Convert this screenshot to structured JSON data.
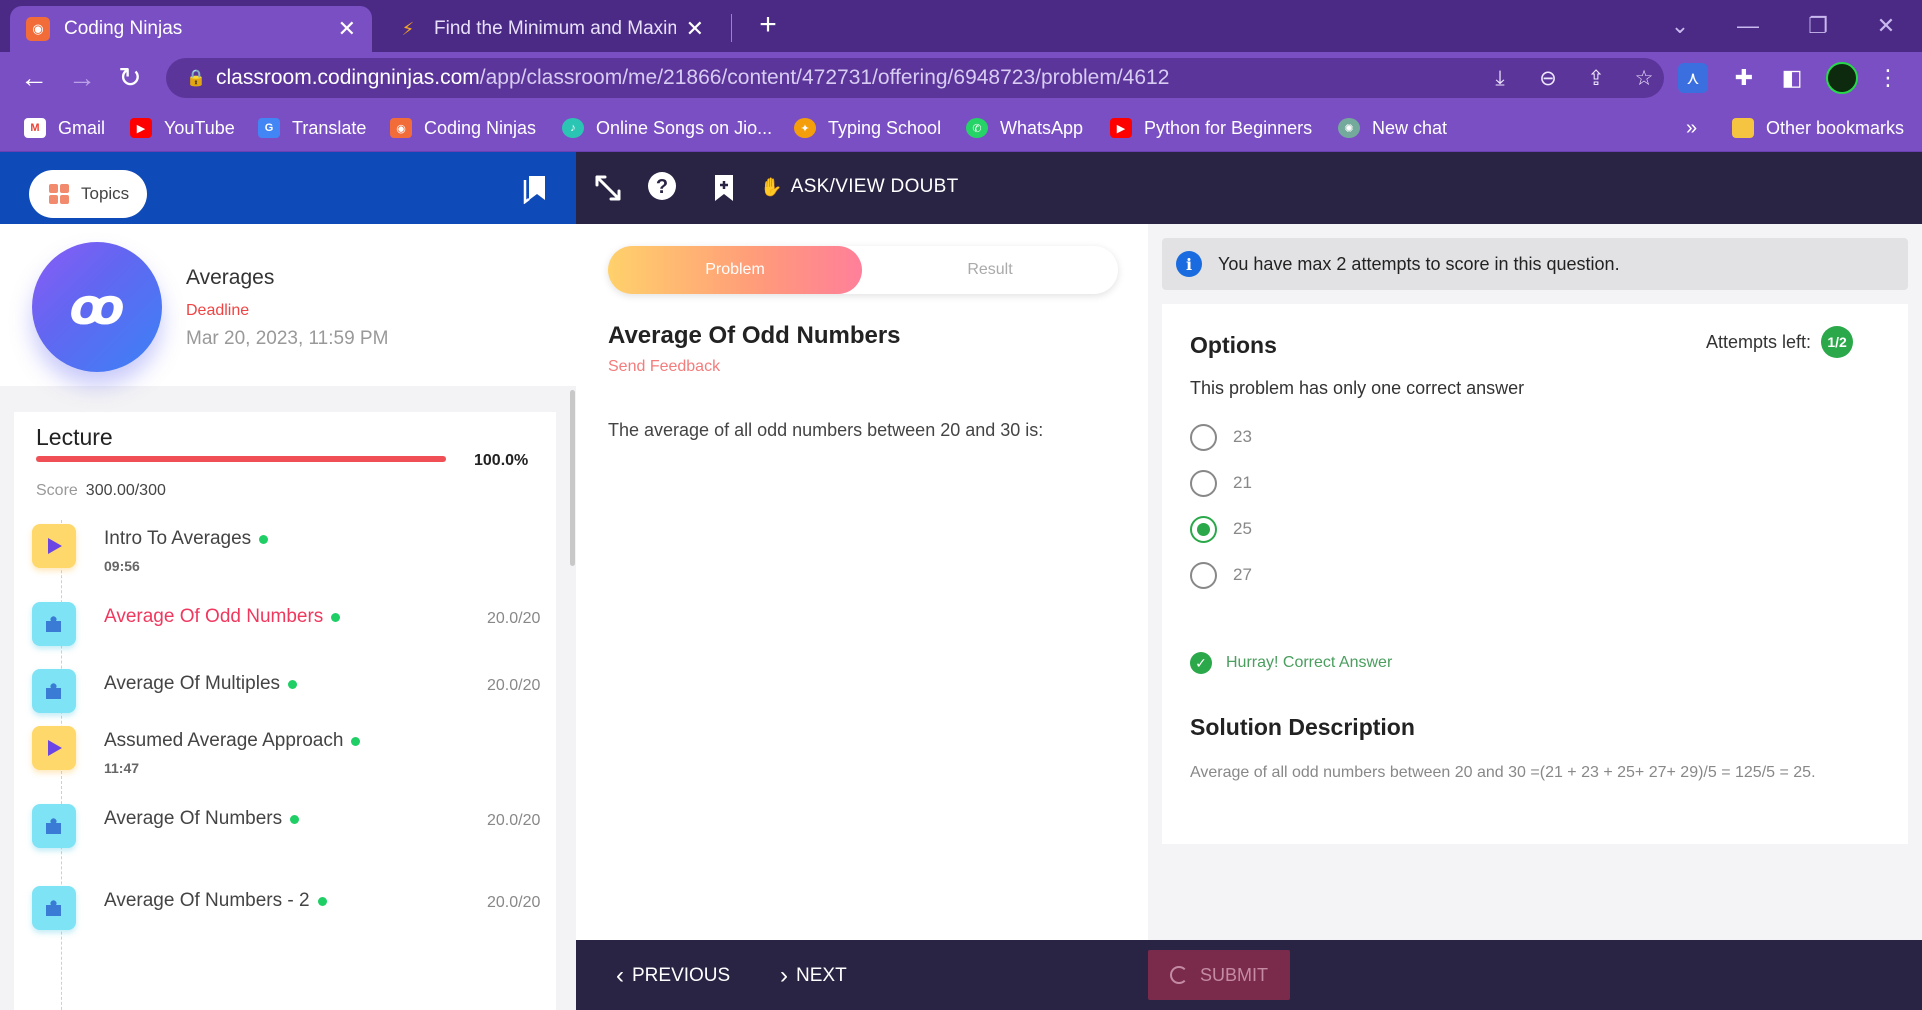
{
  "browser": {
    "tabs": [
      {
        "title": "Coding Ninjas",
        "active": true
      },
      {
        "title": "Find the Minimum and Maximum",
        "active": false
      }
    ],
    "url_host": "classroom.codingninjas.com",
    "url_path": "/app/classroom/me/21866/content/472731/offering/6948723/problem/4612",
    "bookmarks": [
      {
        "label": "Gmail",
        "icon": "gmail-icon",
        "color": "#ea4335"
      },
      {
        "label": "YouTube",
        "icon": "youtube-icon",
        "color": "#ff0000"
      },
      {
        "label": "Translate",
        "icon": "translate-icon",
        "color": "#4285f4"
      },
      {
        "label": "Coding Ninjas",
        "icon": "coding-ninjas-icon",
        "color": "#f26c3a"
      },
      {
        "label": "Online Songs on Jio...",
        "icon": "jiosaavn-icon",
        "color": "#2bc5b4"
      },
      {
        "label": "Typing School",
        "icon": "typing-school-icon",
        "color": "#f59e0b"
      },
      {
        "label": "WhatsApp",
        "icon": "whatsapp-icon",
        "color": "#25d366"
      },
      {
        "label": "Python for Beginners",
        "icon": "youtube-icon",
        "color": "#ff0000"
      },
      {
        "label": "New chat",
        "icon": "chatgpt-icon",
        "color": "#74aa9c"
      }
    ],
    "more_bookmarks": "»",
    "other_bookmarks": "Other bookmarks"
  },
  "header": {
    "topics_label": "Topics",
    "doubt_label": "ASK/VIEW DOUBT"
  },
  "course": {
    "title": "Averages",
    "deadline_label": "Deadline",
    "deadline_date": "Mar 20, 2023, 11:59 PM"
  },
  "lecture": {
    "title": "Lecture",
    "progress_pct": "100.0%",
    "progress_value": 1.0,
    "score_label": "Score",
    "score_value": "300.00/300",
    "items": [
      {
        "name": "Intro To Averages",
        "type": "video",
        "sub": "09:56",
        "score": ""
      },
      {
        "name": "Average Of Odd Numbers",
        "type": "problem",
        "sub": "",
        "score": "20.0/20",
        "current": true
      },
      {
        "name": "Average Of Multiples",
        "type": "problem",
        "sub": "",
        "score": "20.0/20"
      },
      {
        "name": "Assumed Average Approach",
        "type": "video",
        "sub": "11:47",
        "score": ""
      },
      {
        "name": "Average Of Numbers",
        "type": "problem",
        "sub": "",
        "score": "20.0/20"
      },
      {
        "name": "Average Of Numbers - 2",
        "type": "problem",
        "sub": "",
        "score": "20.0/20"
      }
    ]
  },
  "problem": {
    "tab_problem": "Problem",
    "tab_result": "Result",
    "title": "Average Of Odd Numbers",
    "send_feedback": "Send Feedback",
    "question": "The average of all odd numbers between 20 and 30 is:"
  },
  "answer": {
    "info": "You have max 2 attempts to score in this question.",
    "options_title": "Options",
    "attempts_label": "Attempts left:",
    "attempts_value": "1/2",
    "one_correct": "This problem has only one correct answer",
    "options": [
      {
        "label": "23",
        "selected": false
      },
      {
        "label": "21",
        "selected": false
      },
      {
        "label": "25",
        "selected": true
      },
      {
        "label": "27",
        "selected": false
      }
    ],
    "result_text": "Hurray! Correct Answer",
    "solution_title": "Solution Description",
    "solution_text": "Average of all odd numbers between 20 and 30 =(21 + 23 + 25+ 27+ 29)/5 = 125/5 = 25."
  },
  "footer": {
    "previous": "PREVIOUS",
    "next": "NEXT",
    "submit": "SUBMIT"
  },
  "colors": {
    "tab_bar": "#4b2a86",
    "chrome": "#7b4fc4",
    "left_header": "#0e4ab8",
    "dark_header": "#2a2444",
    "accent_red": "#ef4f55",
    "correct_green": "#2aa84a"
  }
}
